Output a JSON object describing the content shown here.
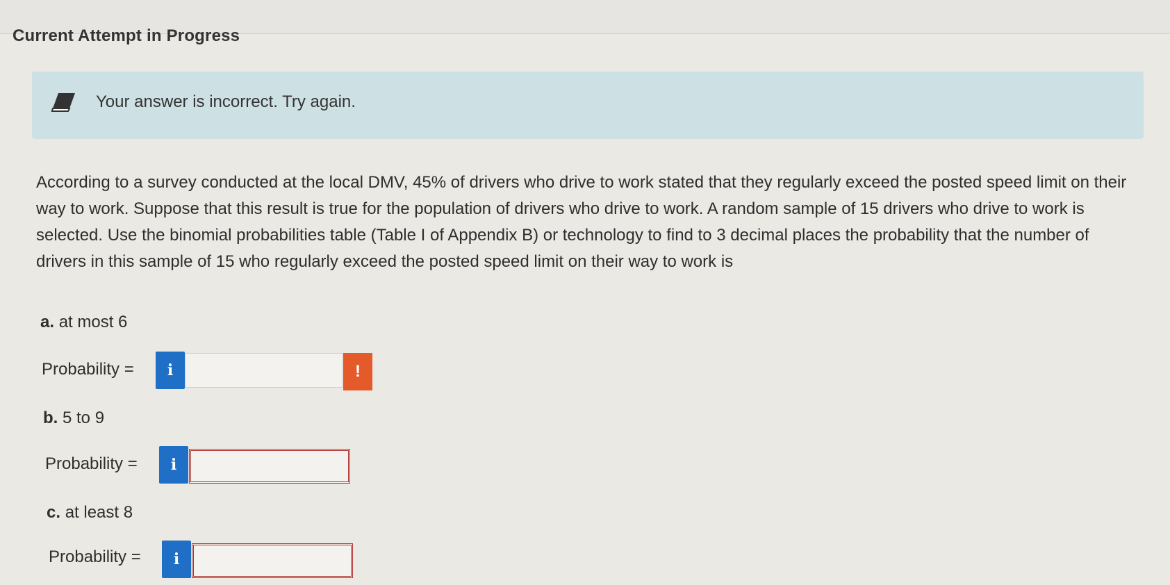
{
  "header": {
    "attempt_title": "Current Attempt in Progress"
  },
  "feedback": {
    "icon": "eraser-icon",
    "message": "Your answer is incorrect. Try again."
  },
  "question": {
    "text": "According to a survey conducted at the local DMV, 45% of drivers who drive to work stated that they regularly exceed the posted speed limit on their way to work. Suppose that this result is true for the population of drivers who drive to work. A random sample of 15 drivers who drive to work is selected. Use the binomial probabilities table (Table I of Appendix B) or technology to find to 3 decimal places the probability that the number of drivers in this sample of 15 who regularly exceed the posted speed limit on their way to work is"
  },
  "parts": [
    {
      "letter": "a.",
      "text": "at most 6",
      "prob_label": "Probability =",
      "info": "i",
      "value": "",
      "warning": "!"
    },
    {
      "letter": "b.",
      "text": "5 to 9",
      "prob_label": "Probability =",
      "info": "i",
      "value": ""
    },
    {
      "letter": "c.",
      "text": "at least 8",
      "prob_label": "Probability =",
      "info": "i",
      "value": ""
    }
  ],
  "colors": {
    "alert_bg": "#cde0e3",
    "info_blue": "#1f6fc7",
    "warn_orange": "#e55a2b",
    "error_red": "#b3322e"
  }
}
